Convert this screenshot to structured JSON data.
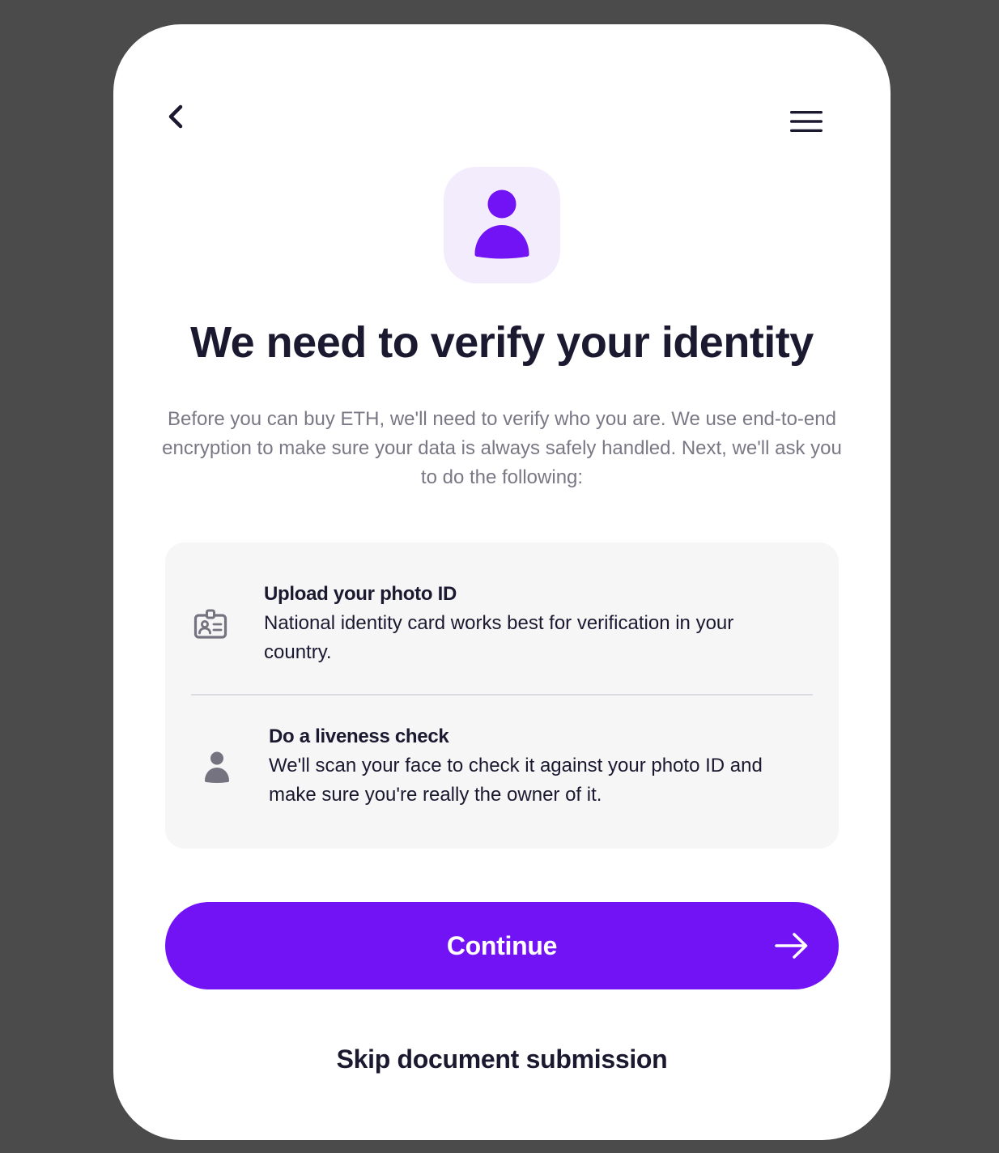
{
  "nav": {
    "back_icon": "chevron-left-icon",
    "menu_icon": "hamburger-menu-icon"
  },
  "hero": {
    "icon": "user-icon",
    "icon_color": "#7213f6",
    "icon_background": "#f3ecfd"
  },
  "title": "We need to verify your identity",
  "description": "Before you can buy ETH, we'll need to verify who you are. We use end-to-end encryption to make sure your data is always safely handled. Next, we'll ask you to do the following:",
  "steps": [
    {
      "icon": "id-card-icon",
      "title": "Upload your photo ID",
      "body": "National identity card works best for verification in your country."
    },
    {
      "icon": "user-icon",
      "title": "Do a liveness check",
      "body": "We'll scan your face to check it against your photo ID and make sure you're really the owner of it."
    }
  ],
  "actions": {
    "continue_label": "Continue",
    "continue_icon": "arrow-right-icon",
    "skip_label": "Skip document submission"
  },
  "colors": {
    "accent": "#7213f6",
    "text_primary": "#1b1930",
    "text_secondary": "#7a7885",
    "panel_background": "#f6f6f7",
    "backdrop": "#4b4b4b"
  }
}
